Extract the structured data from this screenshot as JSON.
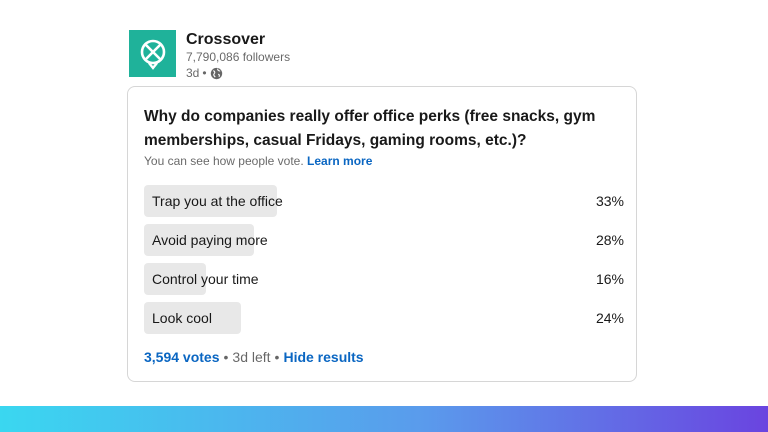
{
  "post": {
    "org_name": "Crossover",
    "followers": "7,790,086 followers",
    "age": "3d",
    "separator": "•",
    "logo_color": "#1fb29a",
    "logo_icon": "crossover-logo-icon",
    "visibility_icon": "globe-icon"
  },
  "poll": {
    "question": "Why do companies really offer office perks (free snacks, gym memberships, casual Fridays, gaming rooms, etc.)?",
    "visibility_text": "You can see how people vote.",
    "learn_more": "Learn more",
    "options": [
      {
        "label": "Trap you at the office",
        "percent_text": "33%",
        "percent": 33
      },
      {
        "label": "Avoid paying more",
        "percent_text": "28%",
        "percent": 28
      },
      {
        "label": "Control your time",
        "percent_text": "16%",
        "percent": 16
      },
      {
        "label": "Look cool",
        "percent_text": "24%",
        "percent": 24
      }
    ],
    "votes": "3,594 votes",
    "time_left": "3d left",
    "hide_results": "Hide results",
    "dot": "•"
  },
  "colors": {
    "link": "#0a66c2",
    "bar": "#e8e8e8",
    "gradient": [
      "#3ad7f0",
      "#5a9bec",
      "#6a44e0"
    ]
  }
}
